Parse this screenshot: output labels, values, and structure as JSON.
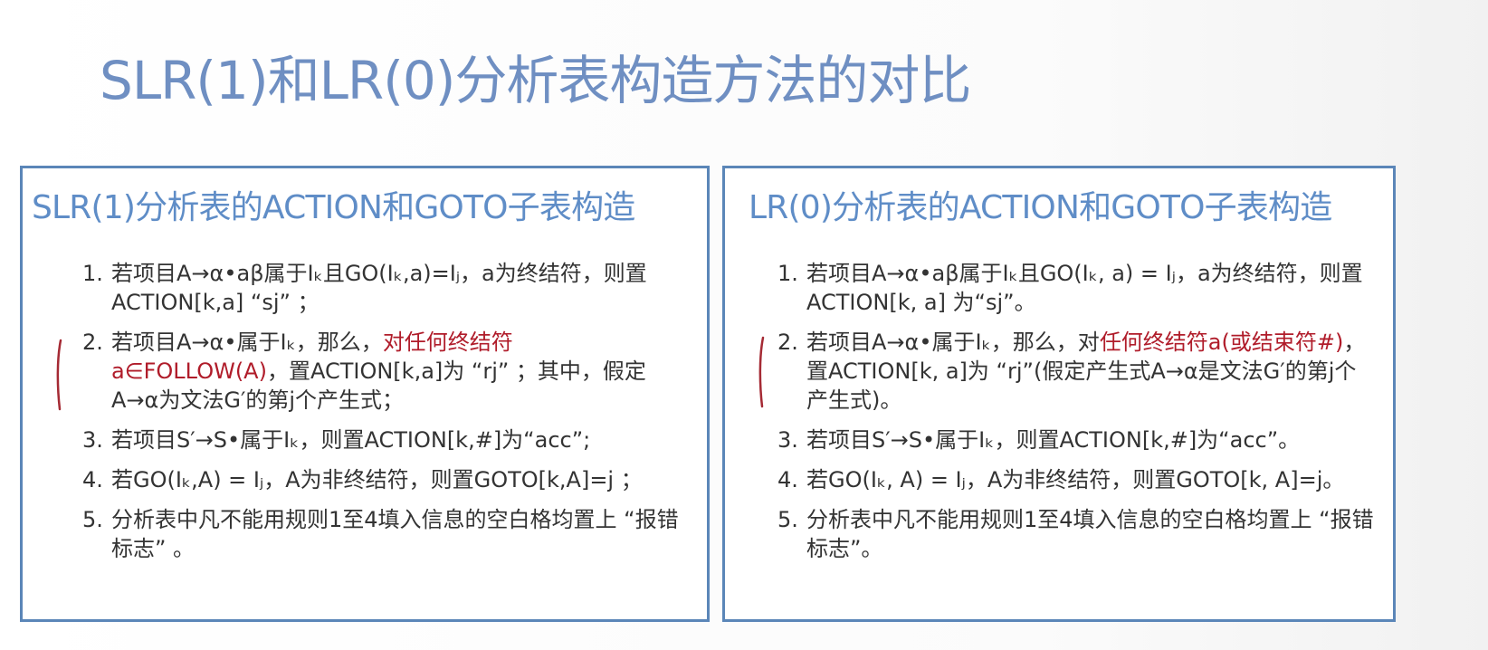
{
  "slide": {
    "title": "SLR(1)和LR(0)分析表构造方法的对比"
  },
  "colors": {
    "title": "#6f8fc2",
    "panel_border": "#5b86b8",
    "highlight": "#b01c2a",
    "annotation": "#a52a34"
  },
  "left_panel": {
    "title": "SLR(1)分析表的ACTION和GOTO子表构造",
    "items": [
      {
        "num": "1.",
        "text": "若项目A→α•aβ属于Iₖ且GO(Iₖ,a)=Iⱼ，a为终结符，则置ACTION[k,a] “sj” ；"
      },
      {
        "num": "2.",
        "text_before": "若项目A→α•属于Iₖ，那么，",
        "text_red": "对任何终结符a∈FOLLOW(A)",
        "text_after": "，置ACTION[k,a]为 “rj” ；其中，假定A→α为文法G′的第j个产生式；"
      },
      {
        "num": "3.",
        "text": "若项目S′→S•属于Iₖ，则置ACTION[k,#]为“acc”;"
      },
      {
        "num": "4.",
        "text": "若GO(Iₖ,A) = Iⱼ，A为非终结符，则置GOTO[k,A]=j ；"
      },
      {
        "num": "5.",
        "text": "分析表中凡不能用规则1至4填入信息的空白格均置上 “报错标志” 。"
      }
    ]
  },
  "right_panel": {
    "title": "LR(0)分析表的ACTION和GOTO子表构造",
    "items": [
      {
        "num": "1.",
        "text": "若项目A→α•aβ属于Iₖ且GO(Iₖ, a) = Iⱼ，a为终结符，则置ACTION[k, a] 为“sj”。"
      },
      {
        "num": "2.",
        "text_before": "若项目A→α•属于Iₖ，那么，对",
        "text_red": "任何终结符a(或结束符#)",
        "text_after": "，置ACTION[k, a]为 “rj”(假定产生式A→α是文法G′的第j个产生式)。"
      },
      {
        "num": "3.",
        "text": "若项目S′→S•属于Iₖ，则置ACTION[k,#]为“acc”。"
      },
      {
        "num": "4.",
        "text": "若GO(Iₖ, A) = Iⱼ，A为非终结符，则置GOTO[k, A]=j。"
      },
      {
        "num": "5.",
        "text": "分析表中凡不能用规则1至4填入信息的空白格均置上 “报错标志”。"
      }
    ]
  }
}
